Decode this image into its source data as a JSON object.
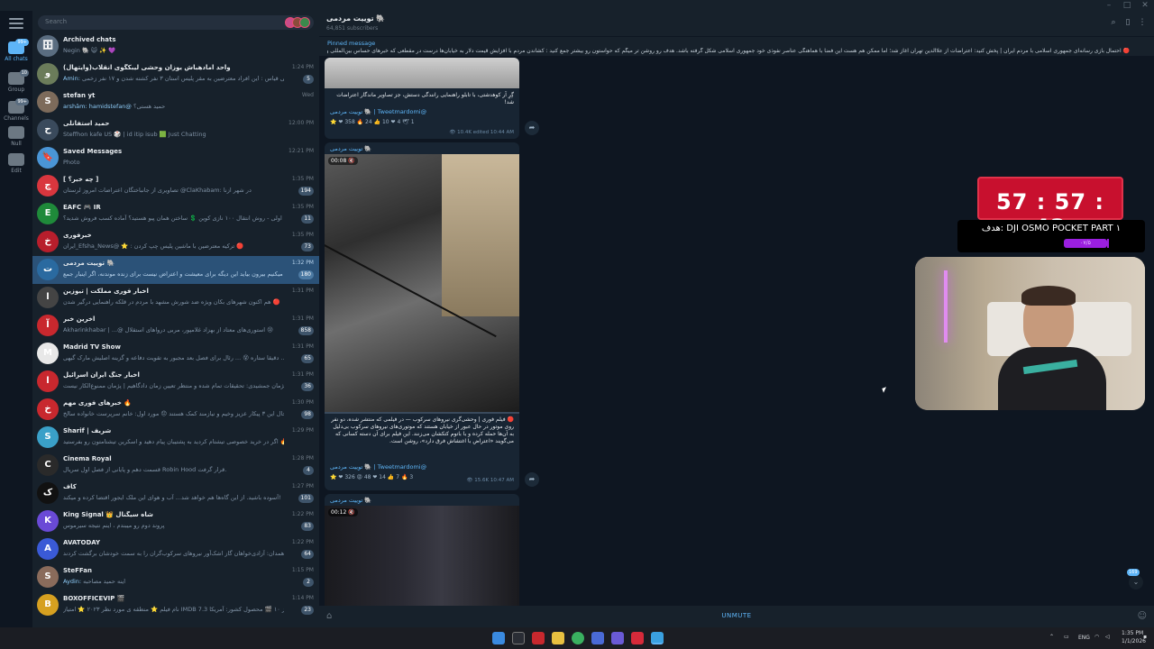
{
  "window": {
    "title": ""
  },
  "folders": [
    {
      "label": "All chats",
      "icon": "chat-bubbles-icon",
      "badge": "99+",
      "active": true
    },
    {
      "label": "Group",
      "icon": "group-icon",
      "badge": "10",
      "active": false
    },
    {
      "label": "Channels",
      "icon": "megaphone-icon",
      "badge": "99+",
      "active": false
    },
    {
      "label": "Null",
      "icon": "glasses-icon",
      "badge": "",
      "active": false
    },
    {
      "label": "Edit",
      "icon": "sliders-icon",
      "badge": "",
      "active": false
    }
  ],
  "search": {
    "placeholder": "Search"
  },
  "chats": [
    {
      "name": "Archived chats",
      "preview": "Negin 🐘 😺 ✨ 💜",
      "sender": "",
      "time": "",
      "count": "",
      "avatar_color": "#5a6d80",
      "avatar_text": "🗄",
      "selected": false
    },
    {
      "name": "واحد امادهباش یوزان وحشی لیبکگوی انقلاب(وایتهال)",
      "preview": "ویکی قیاس : این افراد معترضین به مقر پلیس استان ۳ نفر کشته شدن و ۱۷ نفر زخمی...",
      "sender": "Amin:",
      "time": "1:24 PM",
      "count": "5",
      "avatar_color": "#6b7c5a",
      "avatar_text": "و",
      "selected": false
    },
    {
      "name": "stefan yt",
      "preview": "حمید هستی؟",
      "sender": "arshām: hamidstefan@",
      "time": "Wed",
      "count": "",
      "avatar_color": "#7d6b5b",
      "avatar_text": "S",
      "selected": false
    },
    {
      "name": "حمید استفانلی",
      "preview": "Steffhon kafe US 🎲 | id itip isub 🟩 Just Chatting",
      "sender": "",
      "time": "12:00 PM",
      "count": "",
      "avatar_color": "#3a4a5c",
      "avatar_text": "ح",
      "selected": false
    },
    {
      "name": "Saved Messages",
      "preview": "Photo",
      "sender": "",
      "time": "12:21 PM",
      "count": "",
      "avatar_color": "#4a95d6",
      "avatar_text": "🔖",
      "selected": false
    },
    {
      "name": "[ چه خبر؟ ]",
      "preview": "تصاویری از جانباختگان اعتراضات امروز لرستان @ClaKhabam: در شهر ازنا",
      "sender": "",
      "time": "1:35 PM",
      "count": "194",
      "avatar_color": "#d9363e",
      "avatar_text": "چ",
      "selected": false
    },
    {
      "name": "EAFC 🎮 IR",
      "preview": "اولی - روش انتقال ۱۰۰ نازی کوین 💲 ساختن همان پیو هستید؟ آماده کسب فروش شدید؟",
      "sender": "",
      "time": "1:35 PM",
      "count": "11",
      "avatar_color": "#1f8a3a",
      "avatar_text": "E",
      "selected": false
    },
    {
      "name": "خبرفوری",
      "preview": "ایران_Efsha_News@ ⭐ : ترکیه معترضین با ماشین پلیس چپ کردن 🔴",
      "sender": "",
      "time": "1:35 PM",
      "count": "73",
      "avatar_color": "#b81e2c",
      "avatar_text": "خ",
      "selected": false
    },
    {
      "name": "توییت مردمی 🐘",
      "preview": "خواهش میکنیم بیرون بیاید این دیگه برای معیشت و اعتراض نیست برای زنده موندنه، اگر اینبار جمع...",
      "sender": "",
      "time": "1:32 PM",
      "count": "180",
      "avatar_color": "#2a6aa0",
      "avatar_text": "ت",
      "selected": true
    },
    {
      "name": "اخبار فوری مملکت | تیوزین",
      "preview": "هم اکنون شهرهای بکان ویژه ضد شورش مشهد با مردم در قلکه راهنمایی درگیر شدن 🔴",
      "sender": "",
      "time": "1:31 PM",
      "count": "",
      "avatar_color": "#444",
      "avatar_text": "ا",
      "selected": false
    },
    {
      "name": "آخرین خبر",
      "preview": "Akharinkhabar | ...@ استوری‌های معتاد از بهزاد غلامپور، مربی درواهای استقلال 😢",
      "sender": "",
      "time": "1:31 PM",
      "count": "858",
      "avatar_color": "#c8282e",
      "avatar_text": "آ",
      "selected": false
    },
    {
      "name": "Madrid TV Show",
      "preview": "دقیقا ستاره 😵 ... رئال برای فصل بعد مجبور به تقویت دفاعه و گزینه اصلیش مارک گیهی ...",
      "sender": "",
      "time": "1:31 PM",
      "count": "65",
      "avatar_color": "#e8e8e8",
      "avatar_text": "M",
      "selected": false
    },
    {
      "name": "اخبار جنگ ایران اسرائیل",
      "preview": "وکیل پژمان جمشیدی: تحقیقات تمام شده و منتظر تعیین زمان دادگاهیم | پژمان ممنوع‌الکار نیست...",
      "sender": "",
      "time": "1:31 PM",
      "count": "36",
      "avatar_color": "#c8282e",
      "avatar_text": "ا",
      "selected": false
    },
    {
      "name": "خبرهای فوری مهم 🔥",
      "preview": "حال این ۳ پیکار عزیز وخیم و نیازمند کمک هستند 😞 مورد اول: خانم سرپرست خانواده سالخ...",
      "sender": "",
      "time": "1:30 PM",
      "count": "98",
      "avatar_color": "#c8282e",
      "avatar_text": "خ",
      "selected": false
    },
    {
      "name": "Sharif | شریف",
      "preview": "اگر در خرید خصوصی تیشتام کردید به پشتیبان پیام دهید و اسکرین تیشتامتون رو بفرستید 🔥 ...",
      "sender": "",
      "time": "1:29 PM",
      "count": "",
      "avatar_color": "#3aa0c8",
      "avatar_text": "S",
      "selected": false
    },
    {
      "name": "Cinema Royal",
      "preview": "قسمت دهم و پایانی از فصل اول سریال Robin Hood قرار گرفت.",
      "sender": "",
      "time": "1:28 PM",
      "count": "4",
      "avatar_color": "#2a2a2a",
      "avatar_text": "C",
      "selected": false
    },
    {
      "name": "کاف",
      "preview": "آسوده باشید. از این گاه‌ها هم خواهد شد... آب و هوای این ملک ایجور اقتضا کرده و میکند! ❗",
      "sender": "",
      "time": "1:27 PM",
      "count": "101",
      "avatar_color": "#111",
      "avatar_text": "ک",
      "selected": false
    },
    {
      "name": "King Signal 👑 شاه سیگنال",
      "preview": "پروند دوم رو میبندم ، اینم نتیجه سیرموس",
      "sender": "",
      "time": "1:22 PM",
      "count": "83",
      "avatar_color": "#6a4ad6",
      "avatar_text": "K",
      "selected": false
    },
    {
      "name": "AVATODAY",
      "preview": "همدان: آزادی‌خواهان گاز اشک‌آور نیروهای سرکوب‌گران را به سمت خودشان برگشت کردند. ...",
      "sender": "",
      "time": "1:22 PM",
      "count": "64",
      "avatar_color": "#3a5ad6",
      "avatar_text": "A",
      "selected": false
    },
    {
      "name": "SteFFan",
      "preview": "اینه حمید مصاحبه",
      "sender": "Aydin:",
      "time": "1:15 PM",
      "count": "2",
      "avatar_color": "#8a6b5b",
      "avatar_text": "S",
      "selected": false
    },
    {
      "name": "BOXOFFICEVIP 🎬",
      "preview": "نام فیلم ⭐ منطقه ی مورد نظر ۲۰۲۳ ⭐ امتیاز IMDB 7.3 از ۱۰ 🎬 محصول کشور: آمریکا...",
      "sender": "",
      "time": "1:14 PM",
      "count": "23",
      "avatar_color": "#d6a020",
      "avatar_text": "B",
      "selected": false
    }
  ],
  "chat": {
    "title": "توییت مردمی 🐘",
    "subtitle": "64,851 subscribers",
    "pinned_label": "Pinned message",
    "pinned_text": "🔴 احتمال بازی رسانه‌ای جمهوری اسلامی با مردم ایران | پخش کنید: اعتراضات از علاالدین تهران آغاز شد؛ اما ممکن هم هست این فضا با هماهنگی عناصر نفوذی خود جمهوری اسلامی شکل گرفته باشد. هدف رو روشن تر میگم که حواستون رو بیشتر جمع کنید : کشاندن مردم با افزایش قیمت دلار به خیابان‌ها درست در مقطعی که خبرهای حساس بین‌المللی و ...",
    "messages": [
      {
        "text": "گِرِ آر کوهدشتی، با تابلو راهنمایی رانندگی دستش، جز تصاویر ماندگار اعتراضات شد!",
        "signature": "توییت مردمی 🐘 | Tweetmardomi@",
        "reactions": "⭐ ❤ 358  🔥 24  👍 10  ❤ 4  🕊 1",
        "views": "10.4K",
        "edited": "edited 10:44 AM"
      },
      {
        "author": "توییت مردمی 🐘",
        "duration": "00:08",
        "text": "🔴 فیلم فوری | وحشی‌گری نیروهای سرکوب — در فیلمی که منتشر شده، دو نفر روی موتور در حال عبور از خیابان هستند که موتوری‌های نیروهای سرکوب بی‌دلیل به آن‌ها حمله کرده و با باتوم کتکشان می‌زنند. این فیلم برای آن دسته کسانی که می‌گویند «اعتراض با اغتشاش فرق دارد»، روشن است.",
        "signature": "توییت مردمی 🐘 | Tweetmardomi@",
        "reactions": "⭐ ❤ 326  😡 48  ❤ 14  👍 7  🔥 3",
        "views": "15.6K",
        "edited": "10:47 AM"
      },
      {
        "author": "توییت مردمی 🐘",
        "duration": "00:12"
      }
    ],
    "unread_badge": "169",
    "composer_label": "UNMUTE"
  },
  "overlay": {
    "timer": "57 : 57 : 43",
    "goal_text": "هدف: DJI OSMO POCKET PART ۱",
    "goal_progress_label": "۰۷/۵",
    "accent": "#c8102e"
  },
  "taskbar": {
    "language": "ENG",
    "time": "1:35 PM",
    "date": "1/1/2026"
  }
}
